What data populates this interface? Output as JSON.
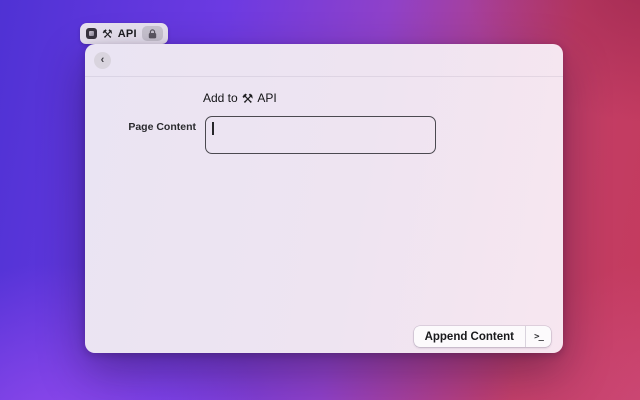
{
  "colors": {
    "bg_purple": "#6c3ae2",
    "bg_crimson": "#c43a5d",
    "window_bg_left": "#eae4f3",
    "window_bg_right": "#f7e6f0",
    "tab_bg": "#e7e1ee",
    "button_bg": "#fcfafc",
    "textarea_border": "#4b4950"
  },
  "tab": {
    "app_icon": "app-icon",
    "tool_glyph": "⚒",
    "label": "API",
    "lock_icon": "lock-icon"
  },
  "window": {
    "back_glyph": "‹",
    "title": {
      "prefix": "Add to",
      "tool_glyph": "⚒",
      "suffix": "API"
    },
    "form": {
      "label": "Page Content",
      "value": ""
    },
    "footer": {
      "button_label": "Append Content",
      "shortcut_glyph": ">_"
    }
  }
}
